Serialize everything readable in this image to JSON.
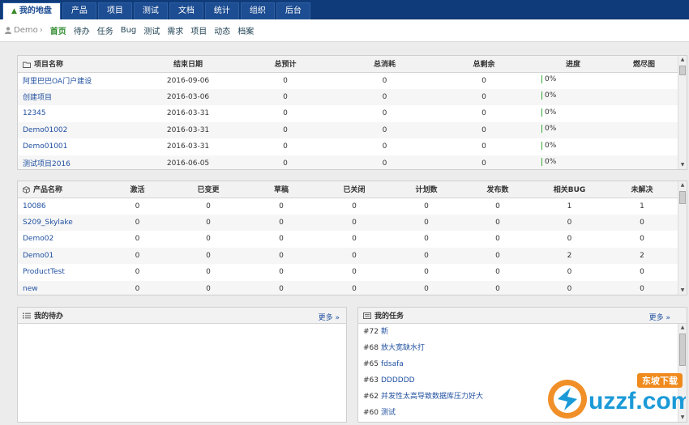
{
  "topnav": {
    "tabs": [
      {
        "label": "我的地盘",
        "active": true
      },
      {
        "label": "产品",
        "active": false
      },
      {
        "label": "项目",
        "active": false
      },
      {
        "label": "测试",
        "active": false
      },
      {
        "label": "文档",
        "active": false
      },
      {
        "label": "统计",
        "active": false
      },
      {
        "label": "组织",
        "active": false
      },
      {
        "label": "后台",
        "active": false
      }
    ]
  },
  "subnav": {
    "user": "Demo",
    "items": [
      {
        "label": "首页",
        "active": true
      },
      {
        "label": "待办",
        "active": false
      },
      {
        "label": "任务",
        "active": false
      },
      {
        "label": "Bug",
        "active": false
      },
      {
        "label": "测试",
        "active": false
      },
      {
        "label": "需求",
        "active": false
      },
      {
        "label": "项目",
        "active": false
      },
      {
        "label": "动态",
        "active": false
      },
      {
        "label": "档案",
        "active": false
      }
    ]
  },
  "projects": {
    "headers": [
      "项目名称",
      "结束日期",
      "总预计",
      "总消耗",
      "总剩余",
      "进度",
      "燃尽图"
    ],
    "rows": [
      {
        "name": "阿里巴巴OA门户建设",
        "end": "2016-09-06",
        "estimate": "0",
        "consumed": "0",
        "left": "0",
        "progress": "0%"
      },
      {
        "name": "创建项目",
        "end": "2016-03-06",
        "estimate": "0",
        "consumed": "0",
        "left": "0",
        "progress": "0%"
      },
      {
        "name": "12345",
        "end": "2016-03-31",
        "estimate": "0",
        "consumed": "0",
        "left": "0",
        "progress": "0%"
      },
      {
        "name": "Demo01002",
        "end": "2016-03-31",
        "estimate": "0",
        "consumed": "0",
        "left": "0",
        "progress": "0%"
      },
      {
        "name": "Demo01001",
        "end": "2016-03-31",
        "estimate": "0",
        "consumed": "0",
        "left": "0",
        "progress": "0%"
      },
      {
        "name": "测试项目2016",
        "end": "2016-06-05",
        "estimate": "0",
        "consumed": "0",
        "left": "0",
        "progress": "0%"
      }
    ]
  },
  "products": {
    "headers": [
      "产品名称",
      "激活",
      "已变更",
      "草稿",
      "已关闭",
      "计划数",
      "发布数",
      "相关BUG",
      "未解决"
    ],
    "rows": [
      {
        "name": "10086",
        "active": "0",
        "changed": "0",
        "draft": "0",
        "closed": "0",
        "plans": "0",
        "releases": "0",
        "bugs": "1",
        "unresolved": "1"
      },
      {
        "name": "S209_Skylake",
        "active": "0",
        "changed": "0",
        "draft": "0",
        "closed": "0",
        "plans": "0",
        "releases": "0",
        "bugs": "0",
        "unresolved": "0"
      },
      {
        "name": "Demo02",
        "active": "0",
        "changed": "0",
        "draft": "0",
        "closed": "0",
        "plans": "0",
        "releases": "0",
        "bugs": "0",
        "unresolved": "0"
      },
      {
        "name": "Demo01",
        "active": "0",
        "changed": "0",
        "draft": "0",
        "closed": "0",
        "plans": "0",
        "releases": "0",
        "bugs": "2",
        "unresolved": "2"
      },
      {
        "name": "ProductTest",
        "active": "0",
        "changed": "0",
        "draft": "0",
        "closed": "0",
        "plans": "0",
        "releases": "0",
        "bugs": "0",
        "unresolved": "0"
      },
      {
        "name": "new",
        "active": "0",
        "changed": "0",
        "draft": "0",
        "closed": "0",
        "plans": "0",
        "releases": "0",
        "bugs": "0",
        "unresolved": "0"
      }
    ]
  },
  "todo": {
    "title": "我的待办",
    "more": "更多 »"
  },
  "tasks": {
    "title": "我的任务",
    "more": "更多 »",
    "items": [
      {
        "id": "#72",
        "name": "新"
      },
      {
        "id": "#68",
        "name": "放大宽缺水打"
      },
      {
        "id": "#65",
        "name": "fdsafa"
      },
      {
        "id": "#63",
        "name": "DDDDDD"
      },
      {
        "id": "#62",
        "name": "并发性太高导致数据库压力好大"
      },
      {
        "id": "#60",
        "name": "测试"
      }
    ]
  },
  "watermark": {
    "brand": "uzzf.com",
    "tag": "东坡下载"
  },
  "colors": {
    "nav_bg": "#0f3b7a",
    "link": "#2050a0",
    "active_green": "#2e8b2e",
    "progress": "#3aa63a",
    "watermark_orange": "#f08a1c",
    "watermark_blue": "#1b9ad8"
  }
}
